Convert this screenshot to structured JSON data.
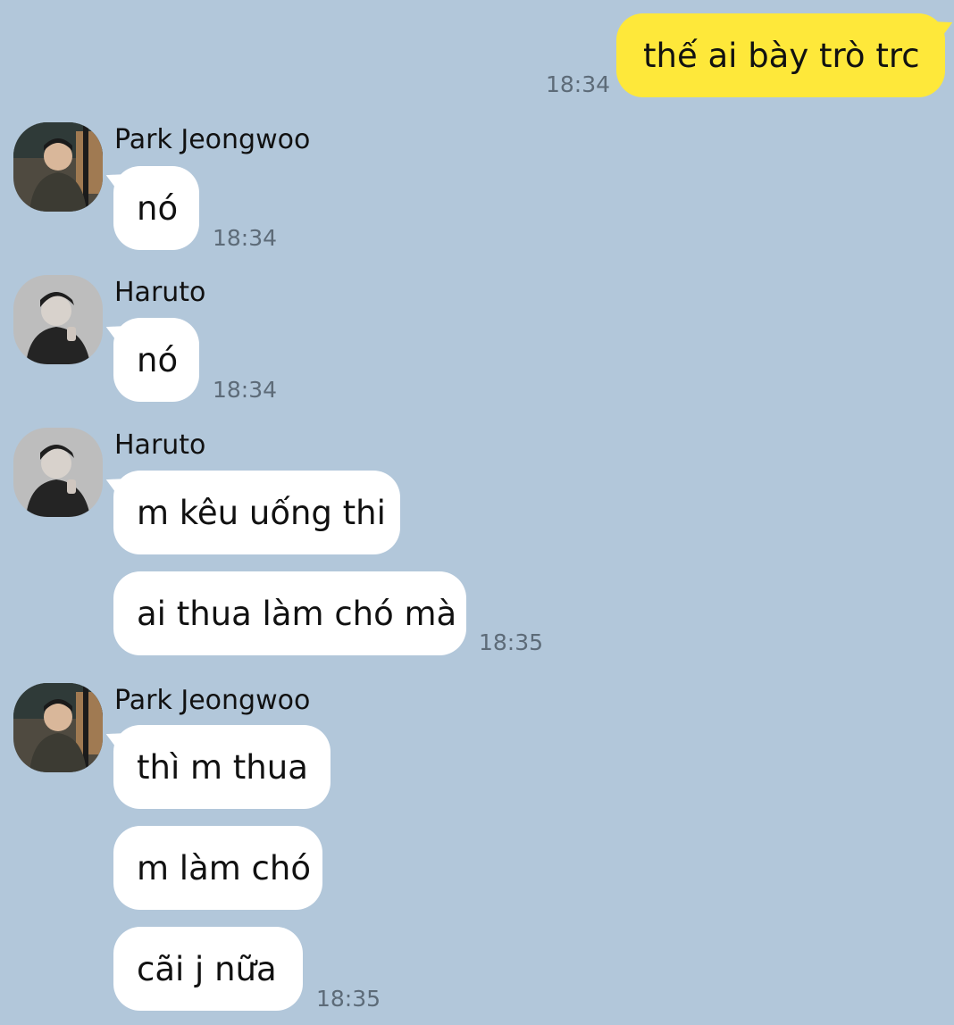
{
  "chat": {
    "messages": {
      "m1": {
        "text": "thế ai bày trò trc",
        "time": "18:34"
      },
      "m2": {
        "sender": "Park Jeongwoo",
        "text": "nó",
        "time": "18:34"
      },
      "m3": {
        "sender": "Haruto",
        "text": "nó",
        "time": "18:34"
      },
      "m4": {
        "sender": "Haruto",
        "text1": "m kêu uống thi",
        "text2": "ai thua làm chó mà",
        "time": "18:35"
      },
      "m5": {
        "sender": "Park Jeongwoo",
        "text1": "thì m thua",
        "text2": "m làm chó",
        "text3": "cãi j nữa",
        "time": "18:35"
      }
    }
  },
  "colors": {
    "background": "#b2c7da",
    "incoming_bubble": "#ffffff",
    "outgoing_bubble": "#fee83a",
    "timestamp": "#5d6b78"
  },
  "icons": {
    "avatar_park": "avatar-photo-icon",
    "avatar_haruto": "avatar-photo-icon"
  }
}
